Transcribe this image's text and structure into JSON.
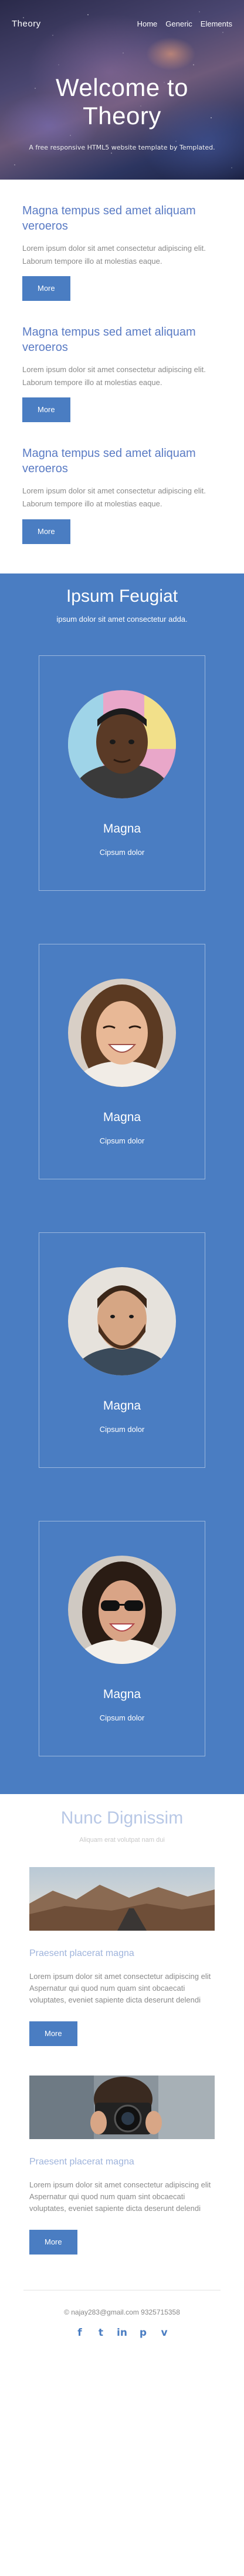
{
  "header": {
    "logo": "Theory",
    "nav": [
      "Home",
      "Generic",
      "Elements"
    ]
  },
  "hero": {
    "title": "Welcome to Theory",
    "subtitle": "A free responsive HTML5 website template by Templated."
  },
  "articles": [
    {
      "title": "Magna tempus sed amet aliquam veroeros",
      "text": "Lorem ipsum dolor sit amet consectetur adipiscing elit. Laborum tempore illo at molestias eaque.",
      "button": "More"
    },
    {
      "title": "Magna tempus sed amet aliquam veroeros",
      "text": "Lorem ipsum dolor sit amet consectetur adipiscing elit. Laborum tempore illo at molestias eaque.",
      "button": "More"
    },
    {
      "title": "Magna tempus sed amet aliquam veroeros",
      "text": "Lorem ipsum dolor sit amet consectetur adipiscing elit. Laborum tempore illo at molestias eaque.",
      "button": "More"
    }
  ],
  "team": {
    "title": "Ipsum Feugiat",
    "lead": "ipsum dolor sit amet consectetur adda.",
    "members": [
      {
        "name": "Magna",
        "role": "Cipsum dolor"
      },
      {
        "name": "Magna",
        "role": "Cipsum dolor"
      },
      {
        "name": "Magna",
        "role": "Cipsum dolor"
      },
      {
        "name": "Magna",
        "role": "Cipsum dolor"
      }
    ]
  },
  "gallery": {
    "title": "Nunc Dignissim",
    "lead": "Aliquam erat volutpat nam dui",
    "items": [
      {
        "title": "Praesent placerat magna",
        "text": "Lorem ipsum dolor sit amet consectetur adipiscing elit Aspernatur qui quod num quam sint obcaecati voluptates, eveniet sapiente dicta deserunt delendi",
        "button": "More"
      },
      {
        "title": "Praesent placerat magna",
        "text": "Lorem ipsum dolor sit amet consectetur adipiscing elit Aspernatur qui quod num quam sint obcaecati voluptates, eveniet sapiente dicta deserunt delendi",
        "button": "More"
      }
    ]
  },
  "footer": {
    "email": "© najay283@gmail.com 9325715358",
    "socials": [
      {
        "icon": "facebook-icon",
        "glyph": "f"
      },
      {
        "icon": "twitter-icon",
        "glyph": "t"
      },
      {
        "icon": "linkedin-icon",
        "glyph": "in"
      },
      {
        "icon": "pinterest-icon",
        "glyph": "p"
      },
      {
        "icon": "vimeo-icon",
        "glyph": "v"
      }
    ]
  },
  "colors": {
    "accent": "#4a7dc2",
    "heading": "#5a7bc4",
    "text": "#8a8a8a"
  }
}
